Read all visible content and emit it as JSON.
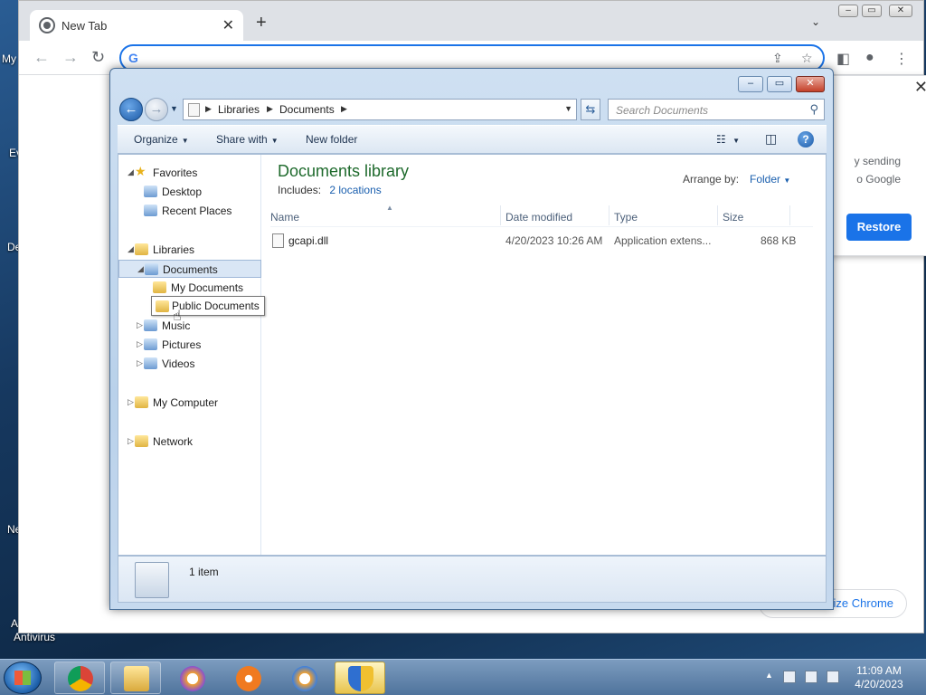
{
  "desktop": {
    "labels": [
      "My",
      "Ev",
      "De",
      "Ne",
      "A",
      "Antivirus"
    ]
  },
  "chrome": {
    "tab_title": "New Tab",
    "new_tab_glyph": "+",
    "omnibox_value": "",
    "popup_text": "y sending\no Google",
    "restore_label": "Restore",
    "customize_label": "ize Chrome"
  },
  "explorer": {
    "breadcrumbs": [
      "Libraries",
      "Documents"
    ],
    "search_placeholder": "Search Documents",
    "commands": {
      "organize": "Organize",
      "share_with": "Share with",
      "new_folder": "New folder"
    },
    "nav_tree": [
      {
        "label": "Favorites",
        "level": 0,
        "expander": "◢"
      },
      {
        "label": "Desktop",
        "level": 1,
        "expander": ""
      },
      {
        "label": "Recent Places",
        "level": 1,
        "expander": ""
      },
      {
        "label": "Libraries",
        "level": 0,
        "expander": "◢"
      },
      {
        "label": "Documents",
        "level": 1,
        "expander": "◢",
        "selected": true
      },
      {
        "label": "My Documents",
        "level": 2,
        "expander": ""
      },
      {
        "label": "Public Documents",
        "level": 2,
        "expander": ""
      },
      {
        "label": "Music",
        "level": 1,
        "expander": "▷"
      },
      {
        "label": "Pictures",
        "level": 1,
        "expander": "▷"
      },
      {
        "label": "Videos",
        "level": 1,
        "expander": "▷"
      },
      {
        "label": "My Computer",
        "level": 0,
        "expander": "▷"
      },
      {
        "label": "Network",
        "level": 0,
        "expander": "▷"
      }
    ],
    "library_title": "Documents library",
    "includes_label": "Includes:",
    "includes_locations": "2 locations",
    "arrange_by_label": "Arrange by:",
    "arrange_by_value": "Folder",
    "columns": [
      "Name",
      "Date modified",
      "Type",
      "Size"
    ],
    "files": [
      {
        "name": "gcapi.dll",
        "date_modified": "4/20/2023 10:26 AM",
        "type": "Application extens...",
        "size": "868 KB"
      }
    ],
    "item_count": "1 item"
  },
  "taskbar": {
    "time": "11:09 AM",
    "date": "4/20/2023"
  },
  "colors": {
    "accent": "#1a73e8",
    "library_title": "#1e6a2c",
    "link": "#1a5fae"
  }
}
